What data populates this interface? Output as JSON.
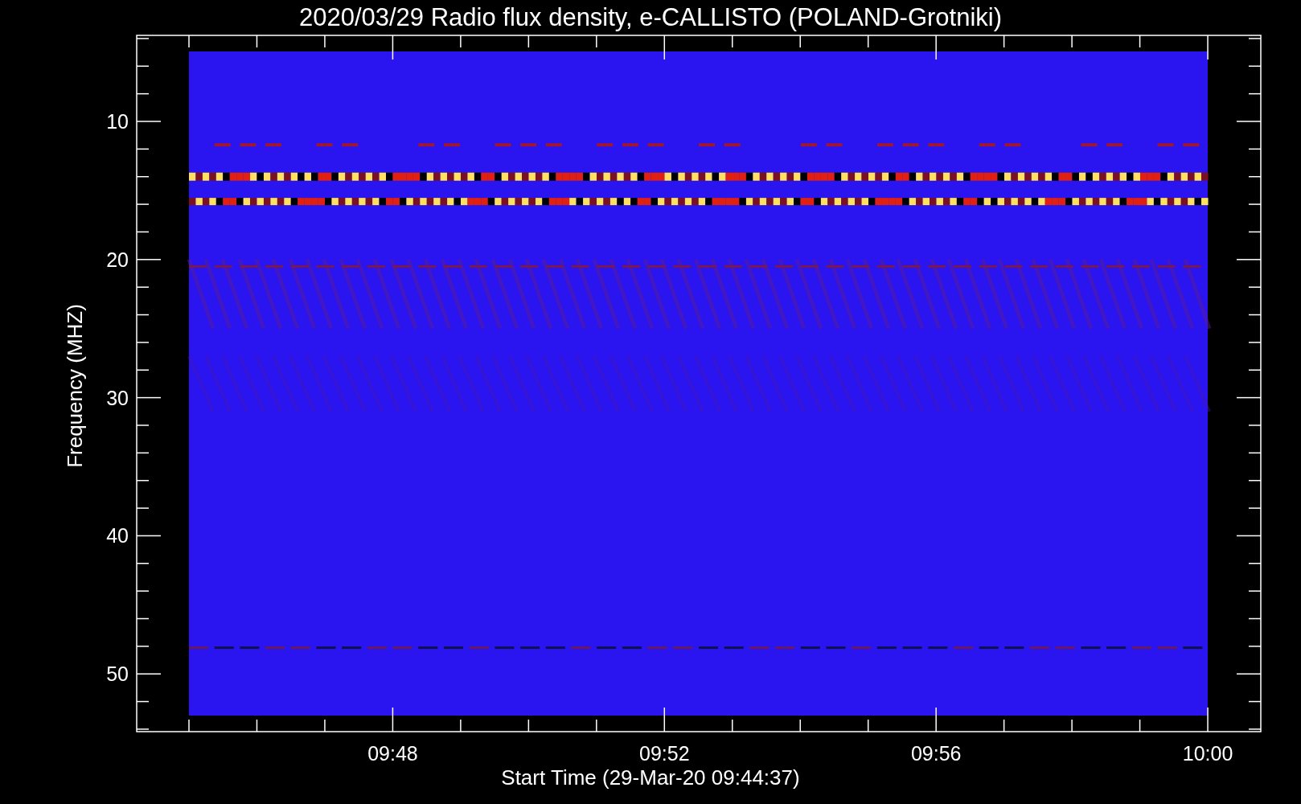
{
  "title": "2020/03/29  Radio flux density, e-CALLISTO (POLAND-Grotniki)",
  "y_axis": {
    "label": "Frequency (MHZ)",
    "ticks": [
      "10",
      "20",
      "30",
      "40",
      "50"
    ]
  },
  "x_axis": {
    "label": "Start Time (29-Mar-20 09:44:37)",
    "ticks": [
      "09:48",
      "09:52",
      "09:56",
      "10:00"
    ]
  }
}
